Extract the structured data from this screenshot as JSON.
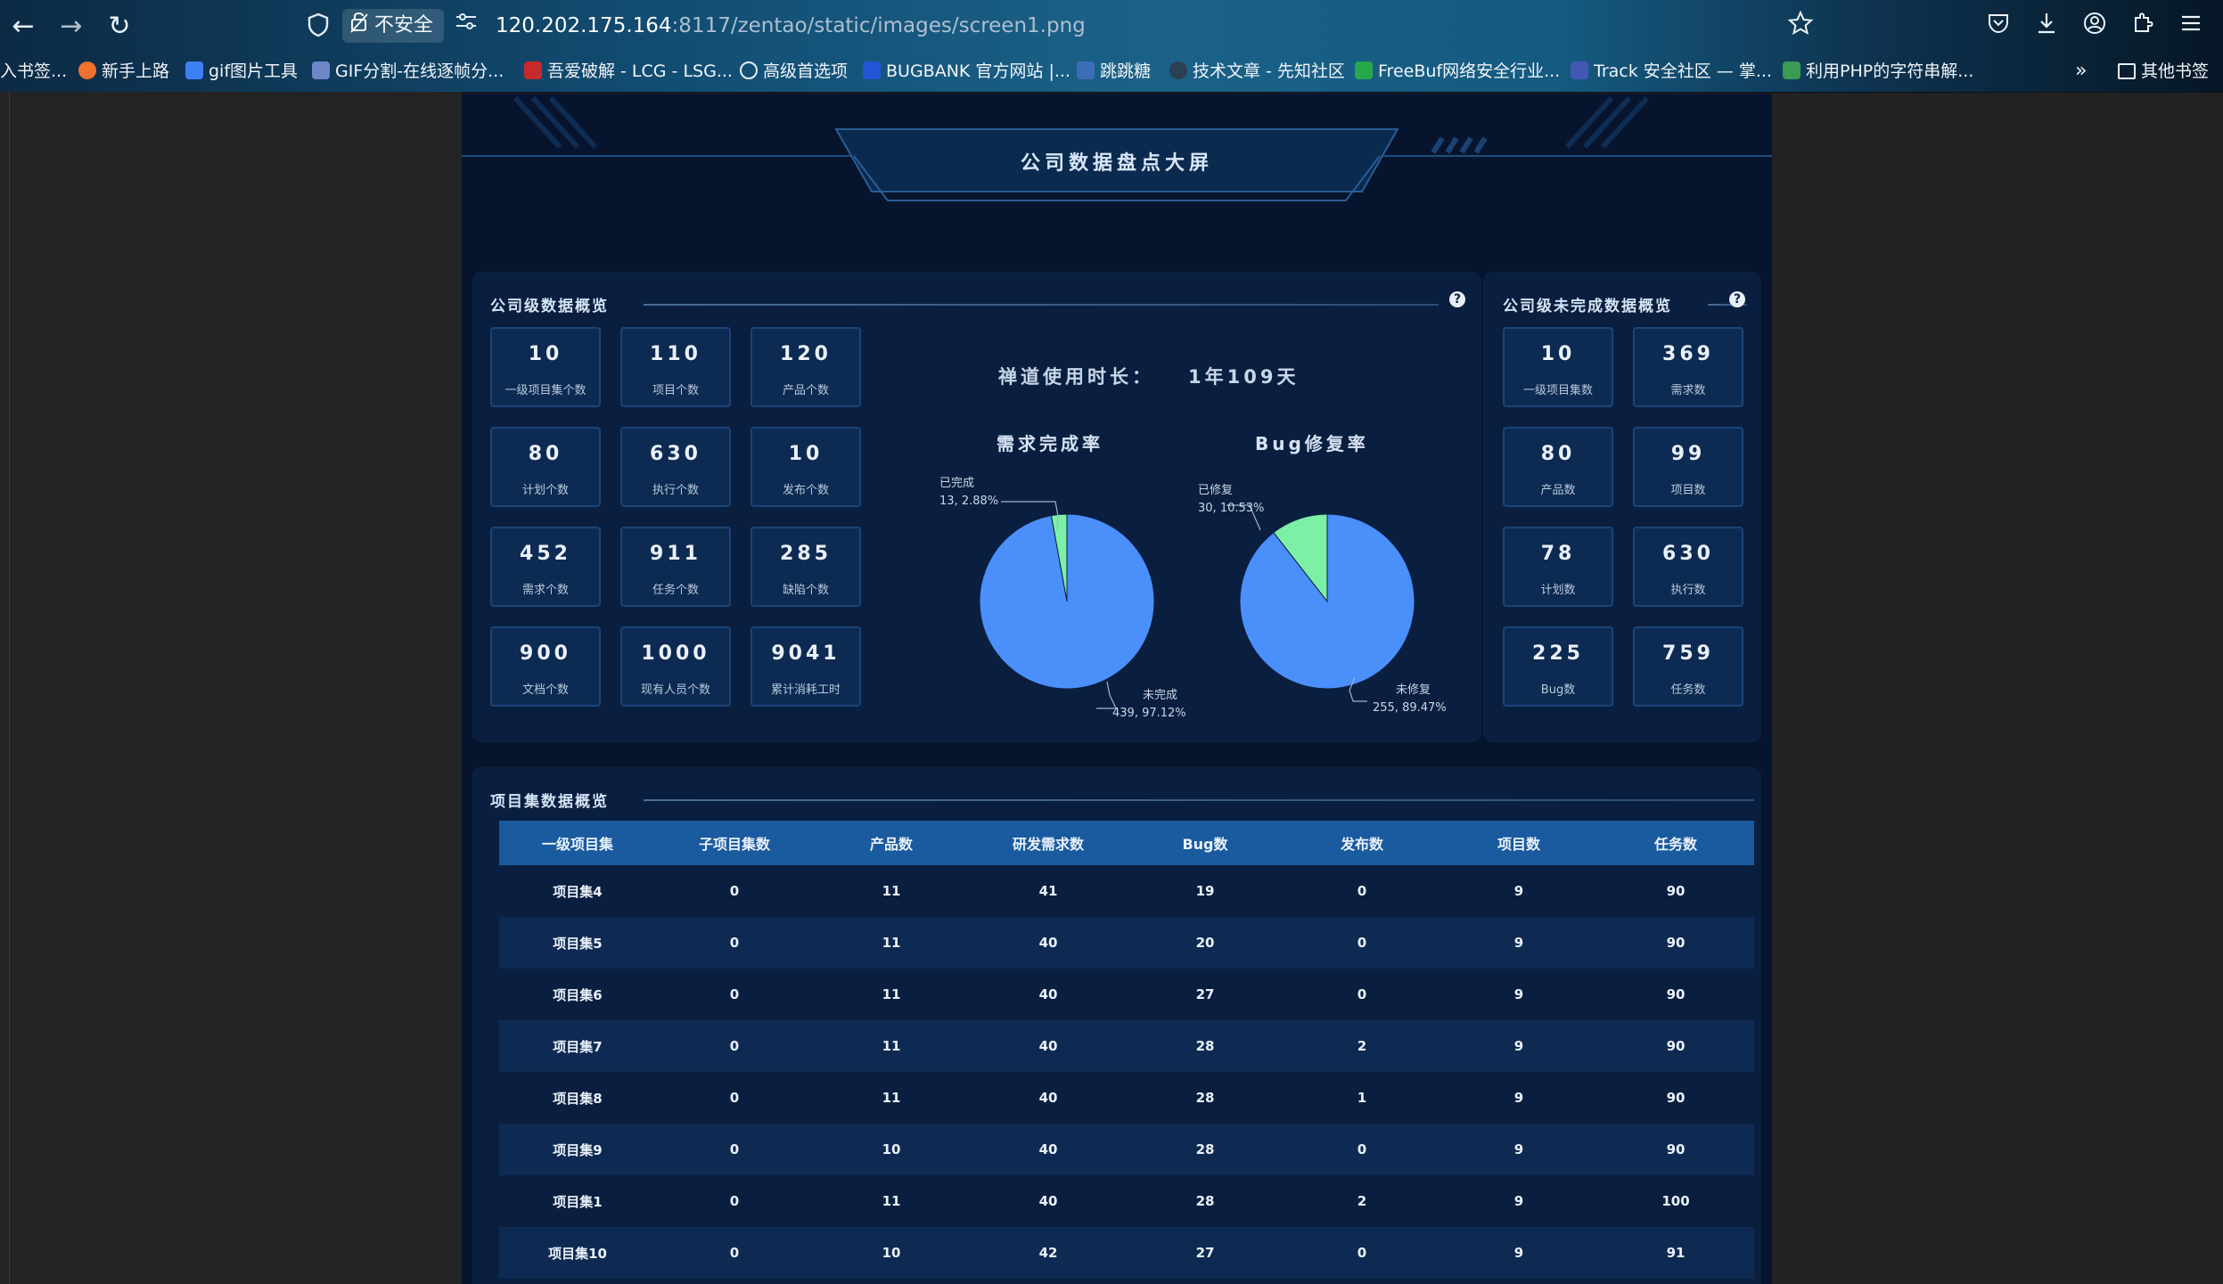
{
  "browser": {
    "nav": {
      "back_icon": "←",
      "forward_icon": "→",
      "reload_icon": "↻"
    },
    "security_label": "不安全",
    "url_host": "120.202.175.164",
    "url_rest": ":8117/zentao/static/images/screen1.png",
    "toolbar_icons": [
      "star-icon",
      "pocket-icon",
      "download-icon",
      "account-icon",
      "extensions-icon",
      "menu-icon"
    ],
    "bookmarks": [
      "入书签...",
      "新手上路",
      "gif图片工具",
      "GIF分割-在线逐帧分...",
      "吾爱破解 - LCG - LSG...",
      "高级首选项",
      "BUGBANK 官方网站 |...",
      "跳跳糖",
      "技术文章 - 先知社区",
      "FreeBuf网络安全行业...",
      "Track 安全社区 — 掌...",
      "利用PHP的字符串解..."
    ],
    "other_bookmarks": "其他书签"
  },
  "page": {
    "title": "公司数据盘点大屏",
    "company_overview": {
      "title": "公司级数据概览",
      "stats": [
        {
          "value": "10",
          "label": "一级项目集个数"
        },
        {
          "value": "110",
          "label": "项目个数"
        },
        {
          "value": "120",
          "label": "产品个数"
        },
        {
          "value": "80",
          "label": "计划个数"
        },
        {
          "value": "630",
          "label": "执行个数"
        },
        {
          "value": "10",
          "label": "发布个数"
        },
        {
          "value": "452",
          "label": "需求个数"
        },
        {
          "value": "911",
          "label": "任务个数"
        },
        {
          "value": "285",
          "label": "缺陷个数"
        },
        {
          "value": "900",
          "label": "文档个数"
        },
        {
          "value": "1000",
          "label": "现有人员个数"
        },
        {
          "value": "9041",
          "label": "累计消耗工时"
        }
      ],
      "usage_label": "禅道使用时长：",
      "usage_value": "1年109天"
    },
    "pies": [
      {
        "title": "需求完成率",
        "slices": [
          {
            "name": "已完成",
            "value": 13,
            "percent": "2.88%",
            "color": "#7cf0a6"
          },
          {
            "name": "未完成",
            "value": 439,
            "percent": "97.12%",
            "color": "#4a8ffa"
          }
        ]
      },
      {
        "title": "Bug修复率",
        "slices": [
          {
            "name": "已修复",
            "value": 30,
            "percent": "10.53%",
            "color": "#7cf0a6"
          },
          {
            "name": "未修复",
            "value": 255,
            "percent": "89.47%",
            "color": "#4a8ffa"
          }
        ]
      }
    ],
    "unfinished_overview": {
      "title": "公司级未完成数据概览",
      "stats": [
        {
          "value": "10",
          "label": "一级项目集数"
        },
        {
          "value": "369",
          "label": "需求数"
        },
        {
          "value": "80",
          "label": "产品数"
        },
        {
          "value": "99",
          "label": "项目数"
        },
        {
          "value": "78",
          "label": "计划数"
        },
        {
          "value": "630",
          "label": "执行数"
        },
        {
          "value": "225",
          "label": "Bug数"
        },
        {
          "value": "759",
          "label": "任务数"
        }
      ]
    },
    "program_table": {
      "title": "项目集数据概览",
      "columns": [
        "一级项目集",
        "子项目集数",
        "产品数",
        "研发需求数",
        "Bug数",
        "发布数",
        "项目数",
        "任务数"
      ],
      "rows": [
        [
          "项目集4",
          "0",
          "11",
          "41",
          "19",
          "0",
          "9",
          "90"
        ],
        [
          "项目集5",
          "0",
          "11",
          "40",
          "20",
          "0",
          "9",
          "90"
        ],
        [
          "项目集6",
          "0",
          "11",
          "40",
          "27",
          "0",
          "9",
          "90"
        ],
        [
          "项目集7",
          "0",
          "11",
          "40",
          "28",
          "2",
          "9",
          "90"
        ],
        [
          "项目集8",
          "0",
          "11",
          "40",
          "28",
          "1",
          "9",
          "90"
        ],
        [
          "项目集9",
          "0",
          "10",
          "40",
          "28",
          "0",
          "9",
          "90"
        ],
        [
          "项目集1",
          "0",
          "11",
          "40",
          "28",
          "2",
          "9",
          "100"
        ],
        [
          "项目集10",
          "0",
          "10",
          "42",
          "27",
          "0",
          "9",
          "91"
        ]
      ]
    },
    "colors": {
      "accent": "#1a5a9e",
      "panel": "#0a1f3f",
      "page_bg": "#06152d",
      "done": "#7cf0a6",
      "open": "#4a8ffa"
    }
  }
}
